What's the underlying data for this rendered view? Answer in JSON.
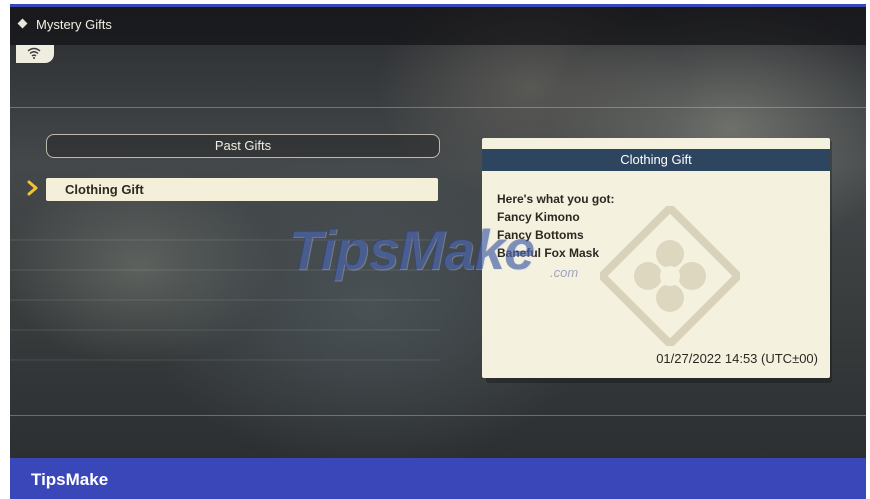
{
  "titlebar": {
    "title": "Mystery Gifts",
    "icon": "diamond-icon"
  },
  "status": {
    "icon": "wifi-icon"
  },
  "list": {
    "header_label": "Past Gifts",
    "items": [
      {
        "label": "Clothing Gift",
        "selected": true
      }
    ],
    "cursor_icon": "chevron-right-icon"
  },
  "detail": {
    "title": "Clothing Gift",
    "lines": [
      "Here's what you got:",
      "Fancy Kimono",
      "Fancy Bottoms",
      "Baneful Fox Mask"
    ],
    "timestamp": "01/27/2022 14:53 (UTC±00)"
  },
  "watermark": {
    "text": "TipsMake",
    "suffix": ".com"
  },
  "footer": {
    "brand": "TipsMake"
  },
  "colors": {
    "accent_blue": "#3a47b8",
    "panel_header": "#2e4560",
    "panel_bg": "#f5f1df",
    "cursor": "#f2c230"
  }
}
